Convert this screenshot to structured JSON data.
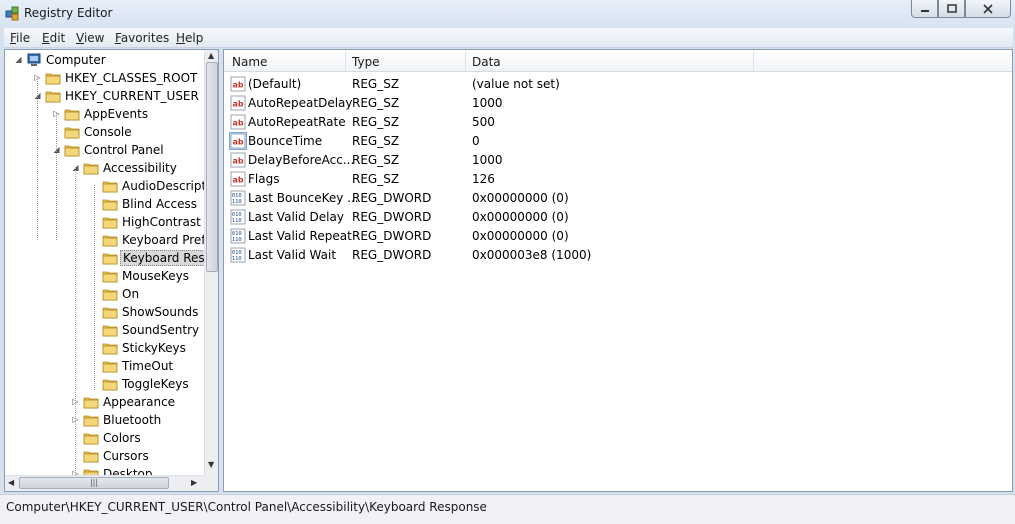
{
  "window": {
    "title": "Registry Editor",
    "icon": "registry-editor-icon",
    "controls": [
      "minimize-icon",
      "maximize-icon",
      "close-icon"
    ]
  },
  "menu": [
    {
      "label": "File"
    },
    {
      "label": "Edit"
    },
    {
      "label": "View"
    },
    {
      "label": "Favorites"
    },
    {
      "label": "Help"
    }
  ],
  "tree": {
    "items": [
      {
        "label": "Computer",
        "depth": 0,
        "expander": "expanded",
        "icon": "computer-icon"
      },
      {
        "label": "HKEY_CLASSES_ROOT",
        "depth": 1,
        "expander": "collapsed",
        "icon": "folder-icon"
      },
      {
        "label": "HKEY_CURRENT_USER",
        "depth": 1,
        "expander": "expanded",
        "icon": "folder-icon"
      },
      {
        "label": "AppEvents",
        "depth": 2,
        "expander": "collapsed",
        "icon": "folder-icon"
      },
      {
        "label": "Console",
        "depth": 2,
        "expander": "none",
        "icon": "folder-icon"
      },
      {
        "label": "Control Panel",
        "depth": 2,
        "expander": "expanded",
        "icon": "folder-icon"
      },
      {
        "label": "Accessibility",
        "depth": 3,
        "expander": "expanded",
        "icon": "folder-icon"
      },
      {
        "label": "AudioDescript",
        "depth": 4,
        "expander": "none",
        "icon": "folder-icon"
      },
      {
        "label": "Blind Access",
        "depth": 4,
        "expander": "none",
        "icon": "folder-icon"
      },
      {
        "label": "HighContrast",
        "depth": 4,
        "expander": "none",
        "icon": "folder-icon"
      },
      {
        "label": "Keyboard Prefe",
        "depth": 4,
        "expander": "none",
        "icon": "folder-icon"
      },
      {
        "label": "Keyboard Resp",
        "depth": 4,
        "expander": "none",
        "icon": "folder-icon",
        "selected": true
      },
      {
        "label": "MouseKeys",
        "depth": 4,
        "expander": "none",
        "icon": "folder-icon"
      },
      {
        "label": "On",
        "depth": 4,
        "expander": "none",
        "icon": "folder-icon"
      },
      {
        "label": "ShowSounds",
        "depth": 4,
        "expander": "none",
        "icon": "folder-icon"
      },
      {
        "label": "SoundSentry",
        "depth": 4,
        "expander": "none",
        "icon": "folder-icon"
      },
      {
        "label": "StickyKeys",
        "depth": 4,
        "expander": "none",
        "icon": "folder-icon"
      },
      {
        "label": "TimeOut",
        "depth": 4,
        "expander": "none",
        "icon": "folder-icon"
      },
      {
        "label": "ToggleKeys",
        "depth": 4,
        "expander": "none",
        "icon": "folder-icon"
      },
      {
        "label": "Appearance",
        "depth": 3,
        "expander": "collapsed",
        "icon": "folder-icon"
      },
      {
        "label": "Bluetooth",
        "depth": 3,
        "expander": "collapsed",
        "icon": "folder-icon"
      },
      {
        "label": "Colors",
        "depth": 3,
        "expander": "none",
        "icon": "folder-icon"
      },
      {
        "label": "Cursors",
        "depth": 3,
        "expander": "none",
        "icon": "folder-icon"
      },
      {
        "label": "Desktop",
        "depth": 3,
        "expander": "collapsed",
        "icon": "folder-icon"
      }
    ]
  },
  "list": {
    "columns": [
      {
        "label": "Name"
      },
      {
        "label": "Type"
      },
      {
        "label": "Data"
      }
    ],
    "rows": [
      {
        "name": "(Default)",
        "type": "REG_SZ",
        "data": "(value not set)",
        "icon": "string-value-icon"
      },
      {
        "name": "AutoRepeatDelay",
        "type": "REG_SZ",
        "data": "1000",
        "icon": "string-value-icon"
      },
      {
        "name": "AutoRepeatRate",
        "type": "REG_SZ",
        "data": "500",
        "icon": "string-value-icon"
      },
      {
        "name": "BounceTime",
        "type": "REG_SZ",
        "data": "0",
        "icon": "string-value-icon",
        "focused": true
      },
      {
        "name": "DelayBeforeAcc...",
        "type": "REG_SZ",
        "data": "1000",
        "icon": "string-value-icon"
      },
      {
        "name": "Flags",
        "type": "REG_SZ",
        "data": "126",
        "icon": "string-value-icon"
      },
      {
        "name": "Last BounceKey ...",
        "type": "REG_DWORD",
        "data": "0x00000000 (0)",
        "icon": "binary-value-icon"
      },
      {
        "name": "Last Valid Delay",
        "type": "REG_DWORD",
        "data": "0x00000000 (0)",
        "icon": "binary-value-icon"
      },
      {
        "name": "Last Valid Repeat",
        "type": "REG_DWORD",
        "data": "0x00000000 (0)",
        "icon": "binary-value-icon"
      },
      {
        "name": "Last Valid Wait",
        "type": "REG_DWORD",
        "data": "0x000003e8 (1000)",
        "icon": "binary-value-icon"
      }
    ]
  },
  "status": {
    "path": "Computer\\HKEY_CURRENT_USER\\Control Panel\\Accessibility\\Keyboard Response"
  },
  "colors": {
    "folder": "#e8c04a",
    "string_icon_text": "#c0392b",
    "binary_icon_text": "#1f4e8c",
    "frame": "#d6e1ef"
  }
}
